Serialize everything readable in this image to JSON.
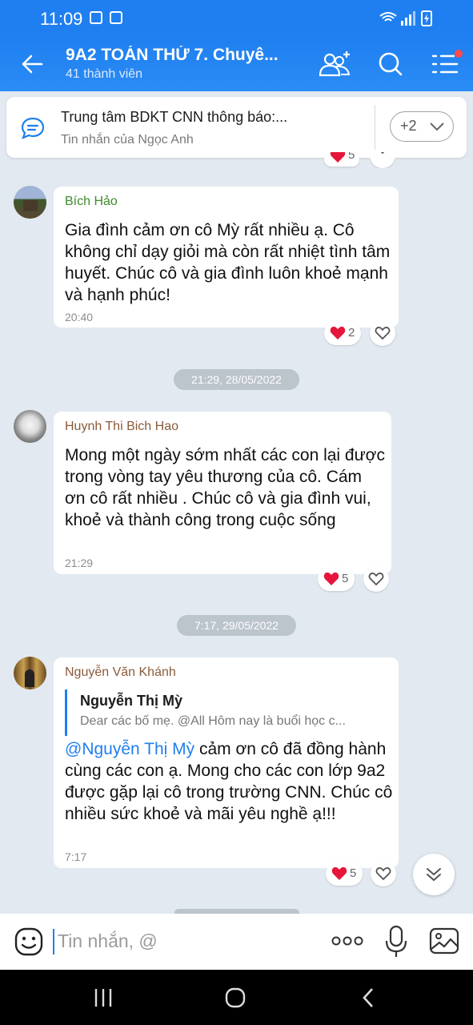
{
  "status_bar": {
    "time": "11:09"
  },
  "header": {
    "title": "9A2 TOÁN THỨ 7. Chuyê...",
    "subtitle": "41 thành viên"
  },
  "pinned": {
    "title": "Trung tâm BDKT CNN thông báo:...",
    "subtitle": "Tin nhắn của Ngọc Anh",
    "more_label": "+2"
  },
  "messages": [
    {
      "sender": "Bích Hảo",
      "text": " Gia đình cảm ơn cô Mỳ rất nhiều ạ. Cô không chỉ dạy giỏi mà còn rất nhiệt tình tâm huyết. Chúc cô và gia đình luôn khoẻ mạnh và hạnh phúc!",
      "time": "20:40",
      "reactions": "2"
    },
    {
      "date": "21:29, 28/05/2022",
      "sender": "Huynh Thi Bich Hao",
      "text": "Mong một ngày sớm nhất các con lại được trong vòng tay yêu thương  của cô. Cám ơn cô rất nhiều . Chúc cô  và gia đình vui, khoẻ và thành công trong cuộc sống",
      "time": "21:29",
      "reactions": "5"
    },
    {
      "date": "7:17, 29/05/2022",
      "sender": "Nguyễn Văn Khánh",
      "quote_name": "Nguyễn Thị Mỳ",
      "quote_text": "Dear các bố mẹ. @All  Hôm nay là buổi học c...",
      "mention": "@Nguyễn Thị Mỳ",
      "text": " cảm ơn cô đã đồng hành cùng các con ạ. Mong cho các con lớp 9a2 được gặp lại cô trong trường CNN. Chúc cô nhiều sức khoẻ và mãi yêu nghề ạ!!!",
      "time": "7:17",
      "reactions": "5"
    }
  ],
  "top_partial_reactions": "5",
  "input": {
    "placeholder": "Tin nhắn, @"
  },
  "colors": {
    "accent": "#1f7ff0",
    "background": "#e2e9f1",
    "heart": "#e5163a"
  }
}
